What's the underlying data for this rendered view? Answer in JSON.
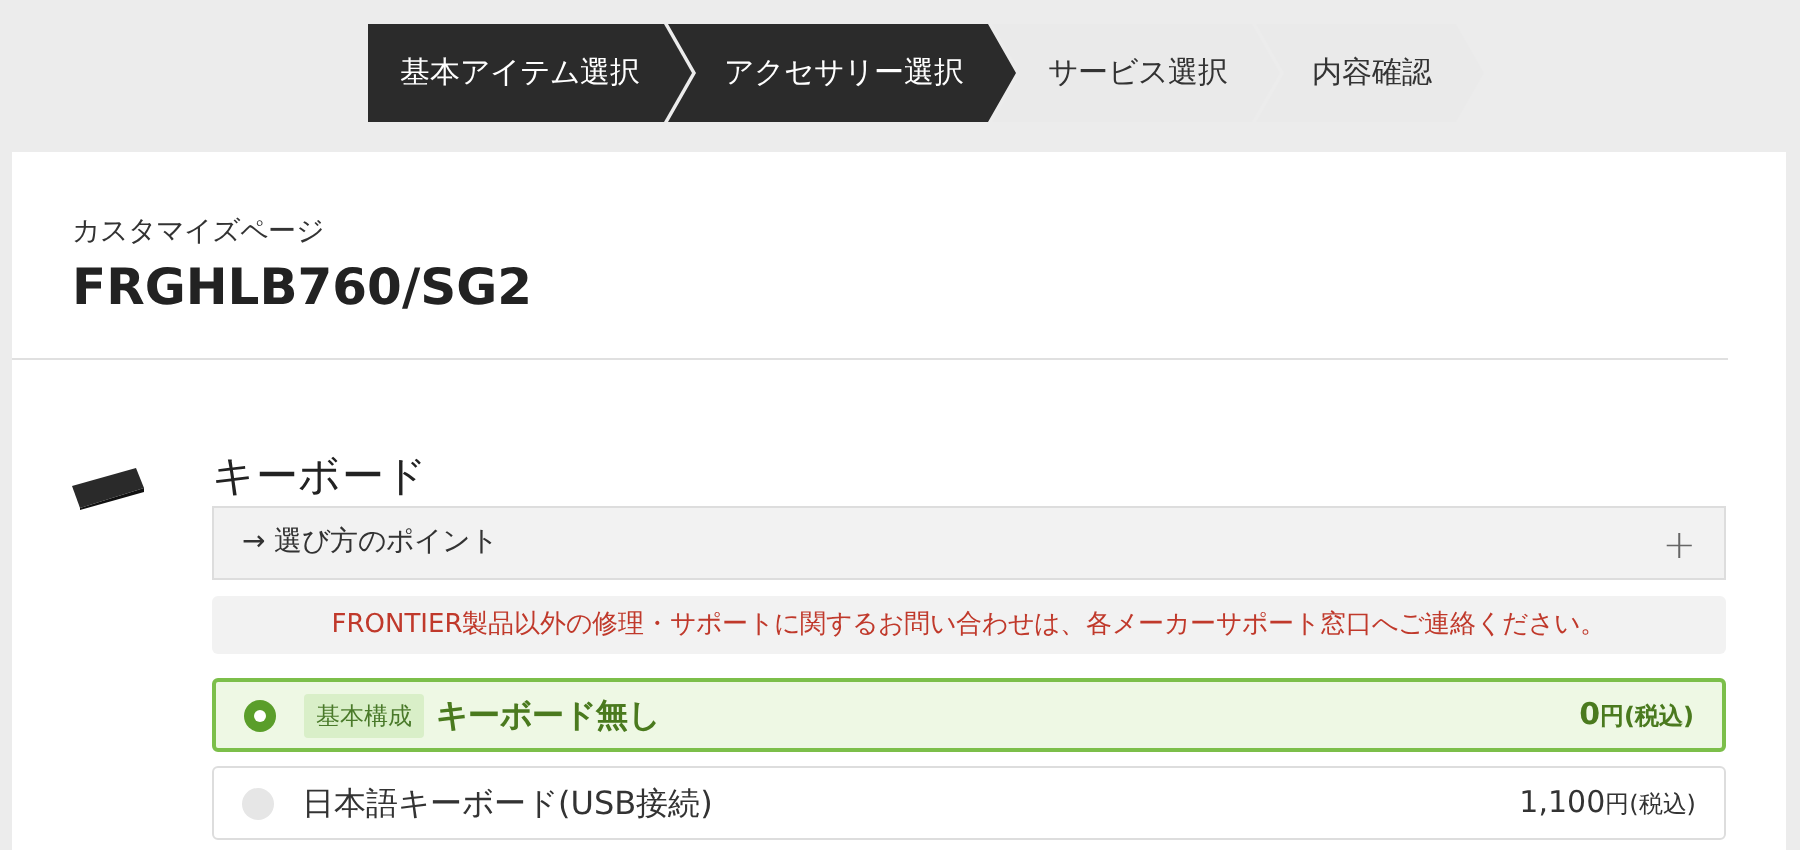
{
  "steps": [
    {
      "label": "基本アイテム選択",
      "active": true
    },
    {
      "label": "アクセサリー選択",
      "active": true
    },
    {
      "label": "サービス選択",
      "active": false
    },
    {
      "label": "内容確認",
      "active": false
    }
  ],
  "page": {
    "subtitle": "カスタマイズページ",
    "title": "FRGHLB760/SG2"
  },
  "section": {
    "heading": "キーボード",
    "accordion": {
      "label": "→ 選び方のポイント",
      "toggle": "+",
      "expanded": false
    },
    "notice": "FRONTIER製品以外の修理・サポートに関するお問い合わせは、各メーカーサポート窓口へご連絡ください。",
    "options": [
      {
        "badge": "基本構成",
        "label": "キーボード無し",
        "amount": "0",
        "unit": "円(税込)",
        "selected": true
      },
      {
        "label": "日本語キーボード(USB接続)",
        "amount": "1,100",
        "unit": "円(税込)",
        "selected": false
      }
    ]
  }
}
